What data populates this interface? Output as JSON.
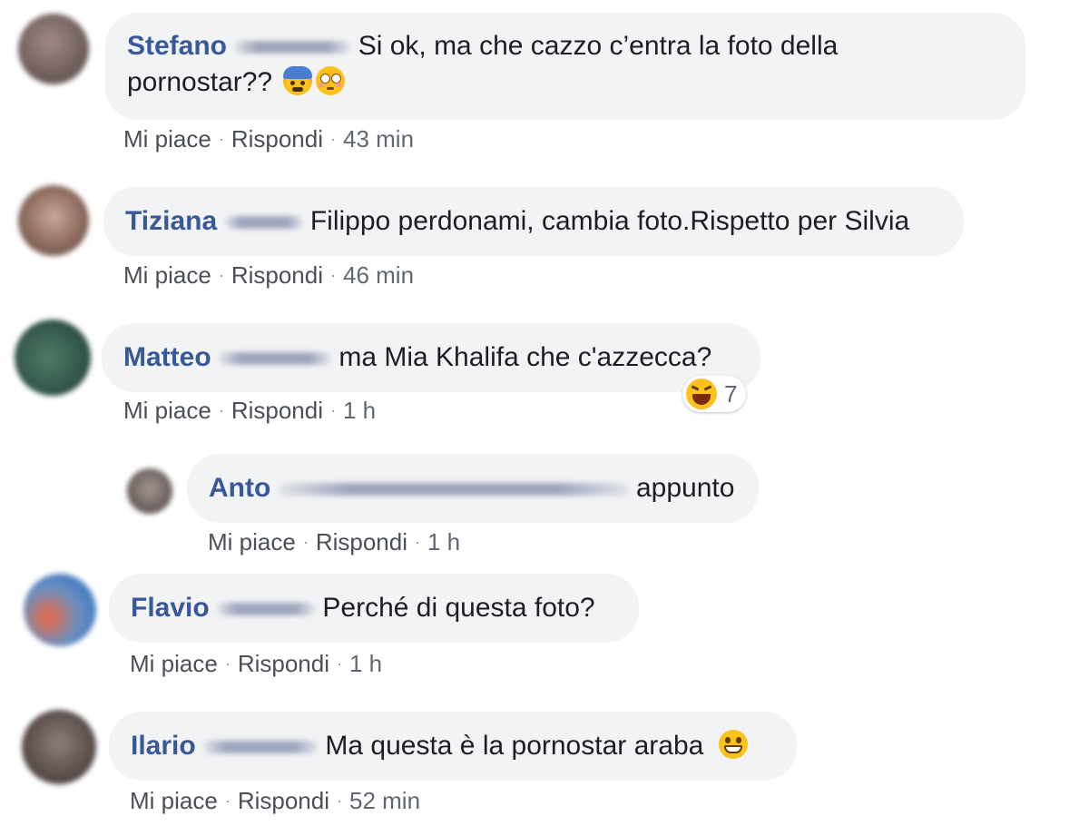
{
  "actions": {
    "like": "Mi piace",
    "reply": "Rispondi",
    "separator": "·"
  },
  "comments": [
    {
      "author": "Stefano",
      "text_line1": "Si ok, ma che cazzo c’entra la foto della",
      "text_line2": "pornostar??",
      "emojis": [
        "anxious-face-emoji",
        "flushed-face-emoji"
      ],
      "time": "43 min"
    },
    {
      "author": "Tiziana",
      "text": "Filippo perdonami, cambia foto.Rispetto per Silvia",
      "time": "46 min"
    },
    {
      "author": "Matteo",
      "text": "ma Mia Khalifa che c'azzecca?",
      "time": "1 h",
      "reaction": {
        "icon": "laughing-face-emoji",
        "count": "7"
      },
      "reply": {
        "author": "Anto",
        "text": "appunto",
        "time": "1 h"
      }
    },
    {
      "author": "Flavio",
      "text": "Perché di questa foto?",
      "time": "1 h"
    },
    {
      "author": "Ilario",
      "text": "Ma questa è la pornostar araba",
      "emojis": [
        "grinning-face-emoji"
      ],
      "time": "52 min"
    }
  ],
  "colors": {
    "author_name": "#385898",
    "bubble_background": "#f2f3f5",
    "meta_text": "#606770"
  }
}
